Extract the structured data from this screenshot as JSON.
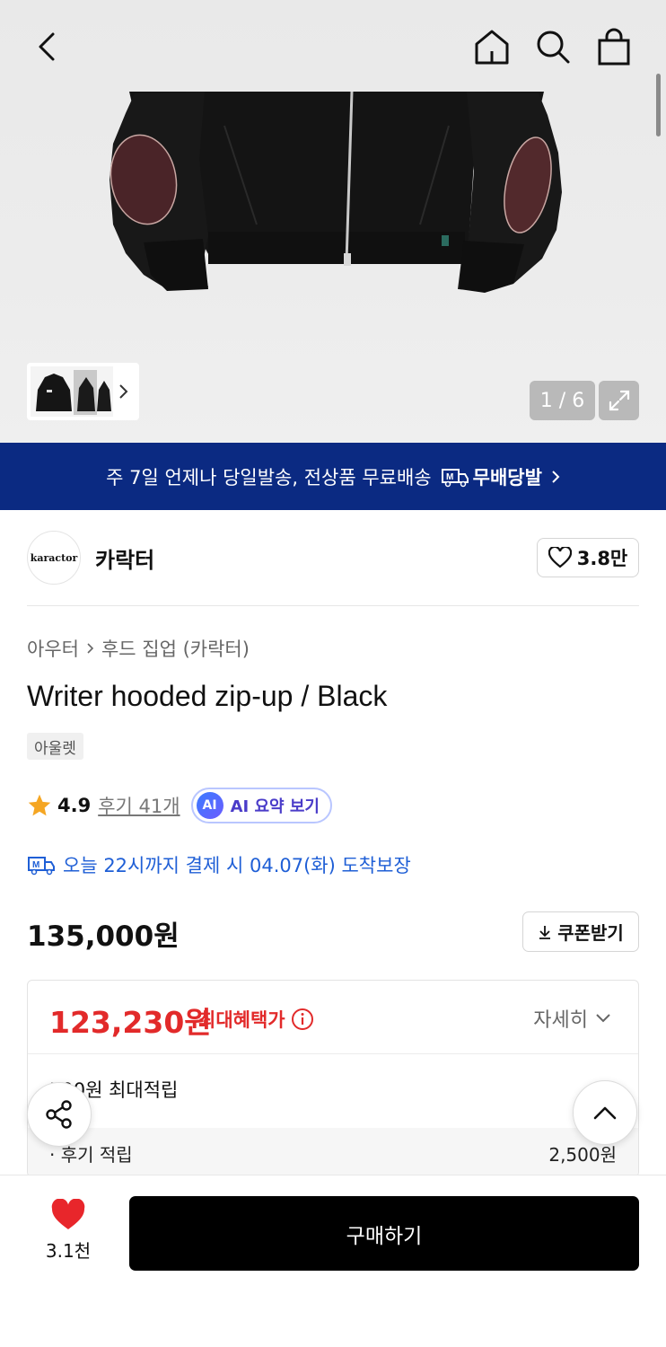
{
  "gallery": {
    "counter": "1 / 6"
  },
  "banner": {
    "text": "주 7일 언제나 당일발송, 전상품 무료배송",
    "badge_label": "무배당발",
    "badge_icon": "truck-m-icon"
  },
  "brand": {
    "logo_text": "karactor",
    "name": "카락터",
    "like_count": "3.8만"
  },
  "breadcrumb": [
    "아우터",
    "후드 집업 (카락터)"
  ],
  "product": {
    "title": "Writer hooded zip-up / Black",
    "tag": "아울렛",
    "rating": "4.9",
    "review_link": "후기 41개",
    "ai_badge": "AI",
    "ai_summary_label": "AI 요약 보기",
    "delivery_text": "오늘 22시까지 결제 시 04.07(화) 도착보장",
    "price": "135,000원",
    "coupon_label": "쿠폰받기"
  },
  "benefits": {
    "max_price": "123,230원",
    "max_label": "최대혜택가",
    "detail_label": "자세히",
    "points_line": "500원 최대적립",
    "items": [
      {
        "label": "· 후기 적립",
        "value": "2,500원"
      }
    ]
  },
  "bottom": {
    "wish_count": "3.1천",
    "buy_label": "구매하기"
  },
  "colors": {
    "banner_bg": "#0b2a82",
    "sale_red": "#e22a2a",
    "delivery_blue": "#1f5fd6",
    "heart_red": "#e8262b",
    "buy_black": "#000000"
  }
}
